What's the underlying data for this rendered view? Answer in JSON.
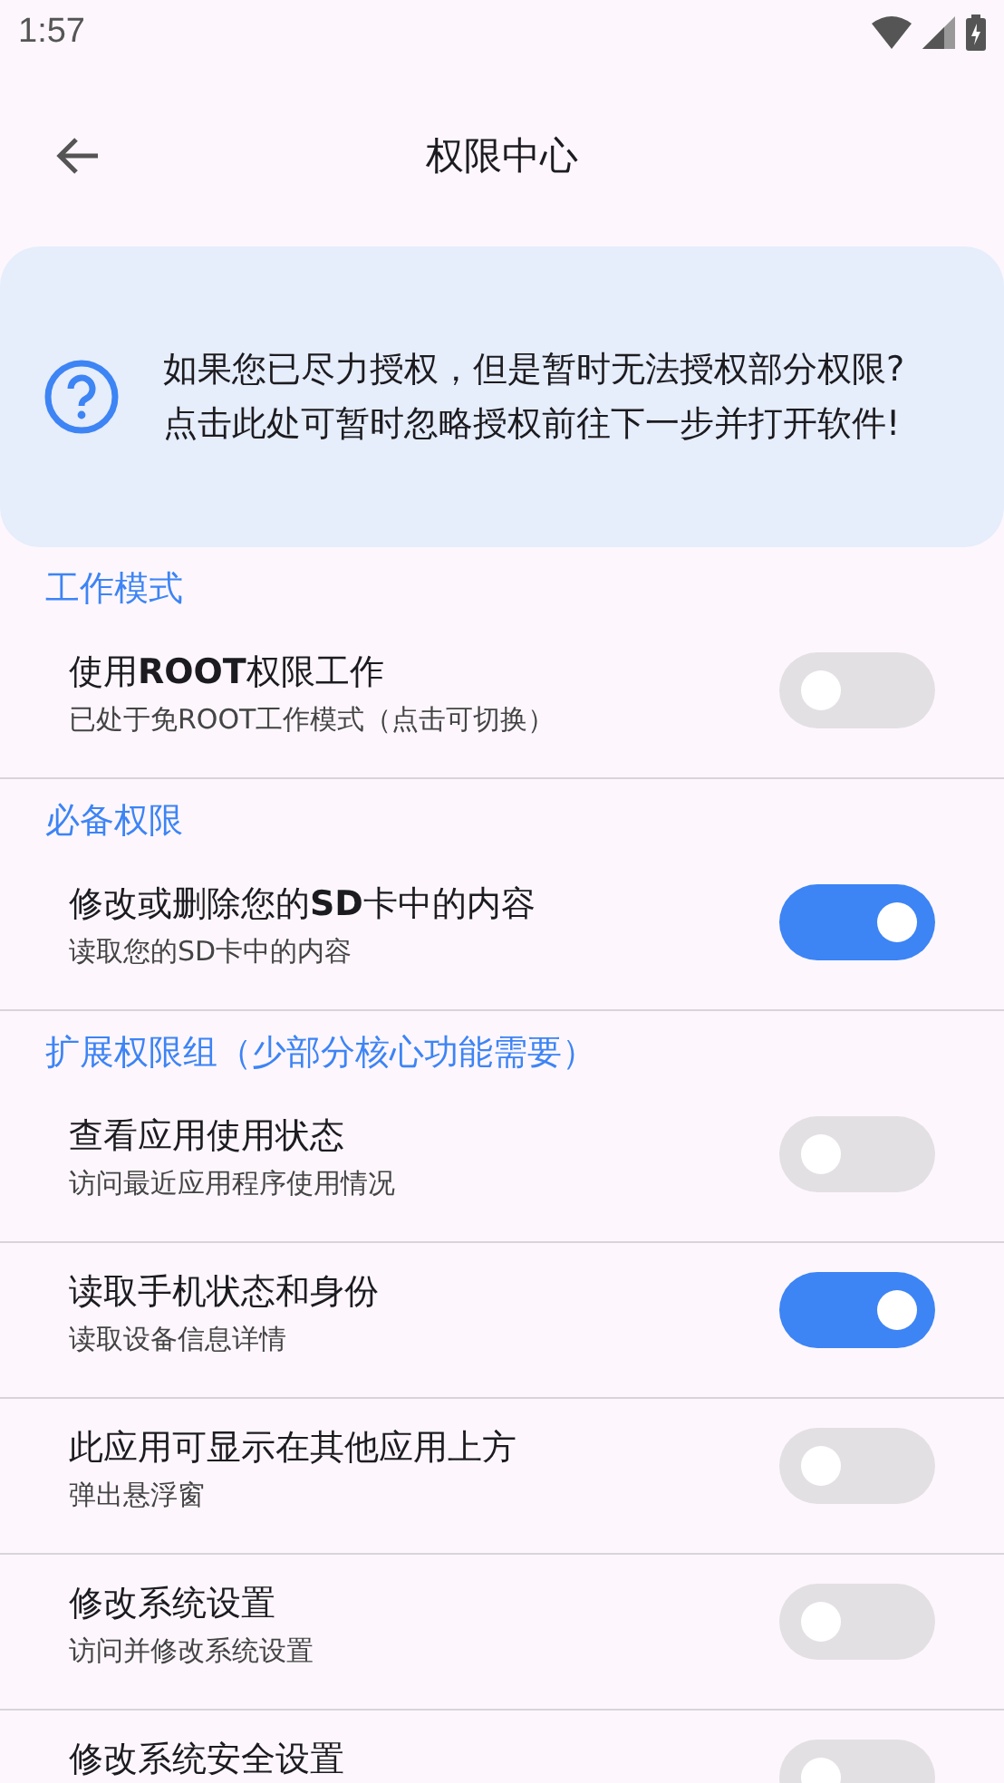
{
  "status_bar": {
    "time": "1:57"
  },
  "app_bar": {
    "title": "权限中心"
  },
  "notice": {
    "text": "如果您已尽力授权，但是暂时无法授权部分权限?\n点击此处可暂时忽略授权前往下一步并打开软件!"
  },
  "sections": [
    {
      "title": "工作模式",
      "items": [
        {
          "title": "使用**ROOT**权限工作",
          "subtitle": "已处于免ROOT工作模式（点击可切换）",
          "on": false
        }
      ]
    },
    {
      "title": "必备权限",
      "items": [
        {
          "title": "修改或删除您的**SD**卡中的内容",
          "subtitle": "读取您的SD卡中的内容",
          "on": true
        }
      ]
    },
    {
      "title": "扩展权限组（少部分核心功能需要）",
      "items": [
        {
          "title": "查看应用使用状态",
          "subtitle": "访问最近应用程序使用情况",
          "on": false
        },
        {
          "title": "读取手机状态和身份",
          "subtitle": "读取设备信息详情",
          "on": true
        },
        {
          "title": "此应用可显示在其他应用上方",
          "subtitle": "弹出悬浮窗",
          "on": false
        },
        {
          "title": "修改系统设置",
          "subtitle": "访问并修改系统设置",
          "on": false
        },
        {
          "title": "修改系统安全设置",
          "on": false
        }
      ]
    }
  ]
}
